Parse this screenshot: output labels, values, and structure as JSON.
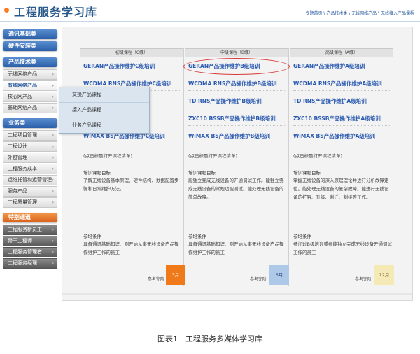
{
  "header": {
    "title": "工程服务学习库",
    "breadcrumb": "专题首页 \\ 产品技术类 \\ 无线网络产品 \\ 无线接入产品课程"
  },
  "sidebar": {
    "sections": [
      {
        "type": "head",
        "label": "通讯基础类"
      },
      {
        "type": "head",
        "label": "硬件安装类"
      },
      {
        "type": "gap"
      },
      {
        "type": "head",
        "label": "产品技术类"
      },
      {
        "type": "item",
        "label": "无线网络产品",
        "arrow": "›"
      },
      {
        "type": "item",
        "label": "有线网络产品",
        "arrow": "›",
        "active": true
      },
      {
        "type": "item",
        "label": "核心网产品",
        "arrow": "›"
      },
      {
        "type": "item",
        "label": "基础网络产品",
        "arrow": "›"
      },
      {
        "type": "gap"
      },
      {
        "type": "head",
        "label": "业务类"
      },
      {
        "type": "item",
        "label": "工程项目管理",
        "arrow": "›"
      },
      {
        "type": "item",
        "label": "工程设计",
        "arrow": "›"
      },
      {
        "type": "item",
        "label": "外包管理",
        "arrow": "›"
      },
      {
        "type": "item",
        "label": "工程服务成本",
        "arrow": "›"
      },
      {
        "type": "item",
        "label": "运维托管和运营管理",
        "arrow": "›"
      },
      {
        "type": "item",
        "label": "服务产品",
        "arrow": "›"
      },
      {
        "type": "item",
        "label": "工程质量管理",
        "arrow": "›"
      },
      {
        "type": "gap"
      },
      {
        "type": "head",
        "label": "特别通道",
        "special": true
      },
      {
        "type": "item",
        "label": "工程服务新员工",
        "arrow": "›",
        "dark": true
      },
      {
        "type": "item",
        "label": "骨干工程师",
        "arrow": "›",
        "dark": true
      },
      {
        "type": "item",
        "label": "工程服务管理者",
        "arrow": "›",
        "dark": true
      },
      {
        "type": "item",
        "label": "工程服务经理",
        "arrow": "›",
        "dark": true
      }
    ]
  },
  "dropdown": {
    "items": [
      "交换产品课程",
      "接入产品课程",
      "业务产品课程"
    ]
  },
  "columns": [
    {
      "header": "初级课程（C级）",
      "courses": [
        "GERAN产品操作维护C级培训",
        "WCDMA RNS产品操作维护C级培训",
        "",
        "",
        "",
        "WiMAX BS产品操作维护C级培训"
      ],
      "hint": "(点击标题打开课程清单)",
      "goal_title": "培训课程目标",
      "goal_text": "了解无线设备基本原理、硬件结构、数据配置步骤和日常维护方法。",
      "req_title": "参培条件",
      "req_text": "具备通讯基础知识、刚开始从事无线设备产品操作维护工作的员工",
      "ref_label": "参考完阶",
      "badge": "3月",
      "badge_color": "orange"
    },
    {
      "header": "中级课程（B级）",
      "courses": [
        "GERAN产品操作维护B级培训",
        "WCDMA RNS产品操作维护B级培训",
        "TD RNS产品操作维护B级培训",
        "ZXC10 BSSB产品操作维护B级培训",
        "WiMAX BS产品操作维护B级培训"
      ],
      "hint": "(点击标题打开课程清单)",
      "goal_title": "培训课程目标",
      "goal_text": "能独立完成无线设备的开通调试工作。能独立完成无线设备的常规功能测试。能处理无线设备的简单故障。",
      "req_title": "参培条件",
      "req_text": "具备通讯基础知识、刚开始从事无线设备产品操作维护工作的员工",
      "ref_label": "参考完阶",
      "badge": "6月",
      "badge_color": "blue"
    },
    {
      "header": "高级课程（A级）",
      "courses": [
        "GERAN产品操作维护A级培训",
        "WCDMA RNS产品操作维护A级培训",
        "TD RNS产品操作维护A级培训",
        "ZXC10 BSSB产品操作维护A级培训",
        "WiMAX BS产品操作维护A级培训"
      ],
      "hint": "(点击标题打开课程清单)",
      "goal_title": "培训课程目标",
      "goal_text": "掌握无线设备的深入原理理论并进行分析故障定位。能处理无线设备的复杂故障。能进行无线设备的扩容、升级、割迁、割接等工作。",
      "req_title": "参培条件",
      "req_text": "参加过B级培训或者能独立完成无线设备开通调试工作的员工",
      "ref_label": "参考完阶",
      "badge": "12月",
      "badge_color": "yellow"
    }
  ],
  "caption": "图表1　工程服务多媒体学习库",
  "colors": {
    "title_blue": "#2a5a8c",
    "link_blue": "#2a5ab0",
    "accent_orange": "#f07a1a",
    "highlight_red": "#d83a3a"
  }
}
